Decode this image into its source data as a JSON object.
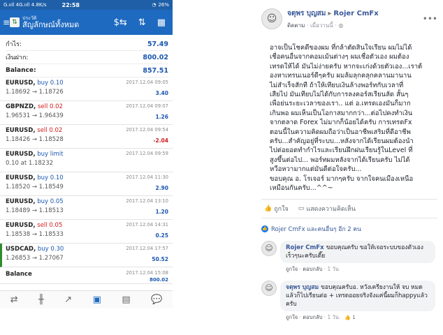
{
  "phone": {
    "status": {
      "left": "G.ııll 4G.ııll 4.8K/s",
      "time": "22:58",
      "right": "26%"
    },
    "app": {
      "sub": "ประวัติ",
      "title": "สัญลักษณ์ทั้งหมด"
    },
    "summary": [
      {
        "label": "กำไร:",
        "value": "57.49"
      },
      {
        "label": "เงินฝาก:",
        "value": "800.02"
      },
      {
        "label": "Balance:",
        "value": "857.51"
      }
    ],
    "trades": [
      {
        "symbol": "EURUSD,",
        "side": "buy 0.10",
        "type": "buy",
        "prices": "1.18692 → 1.18726",
        "date": "2017.12.04 09:05",
        "pl": "3.40",
        "plclass": "pos"
      },
      {
        "symbol": "GBPNZD,",
        "side": "sell 0.02",
        "type": "sell",
        "prices": "1.96531 → 1.96439",
        "date": "2017.12.04 09:07",
        "pl": "1.26",
        "plclass": "pos"
      },
      {
        "symbol": "EURUSD,",
        "side": "sell 0.02",
        "type": "sell",
        "prices": "1.18426 → 1.18528",
        "date": "2017.12.04 09:54",
        "pl": "-2.04",
        "plclass": "neg"
      },
      {
        "symbol": "EURUSD,",
        "side": "buy limit",
        "type": "buy",
        "prices": "0.10 at 1.18232",
        "date": "2017.12.04 09:59",
        "pl": "",
        "plclass": "pos"
      },
      {
        "symbol": "EURUSD,",
        "side": "buy 0.10",
        "type": "buy",
        "prices": "1.18520 → 1.18549",
        "date": "2017.12.04 11:30",
        "pl": "2.90",
        "plclass": "pos"
      },
      {
        "symbol": "EURUSD,",
        "side": "buy 0.05",
        "type": "buy",
        "prices": "1.18489 → 1.18513",
        "date": "2017.12.04 13:10",
        "pl": "1.20",
        "plclass": "pos"
      },
      {
        "symbol": "EURUSD,",
        "side": "sell 0.05",
        "type": "sell",
        "prices": "1.18538 → 1.18533",
        "date": "2017.12.04 14:31",
        "pl": "0.25",
        "plclass": "pos"
      },
      {
        "symbol": "USDCAD,",
        "side": "buy 0.30",
        "type": "buy",
        "prices": "1.26853 → 1.27067",
        "date": "2017.12.04 17:57",
        "pl": "50.52",
        "plclass": "pos"
      }
    ],
    "closed": {
      "label": "Balance",
      "date": "2017.12.04 15:08",
      "value": "800.02"
    }
  },
  "fb": {
    "post": {
      "author": "จตุพร บุญสม",
      "target": "Rojer CmFx",
      "follow": "ติดตาม",
      "time": "เมื่อวานนี้",
      "text": "อาจเป็นโชคดีของผม ที่กล้าตัดสินใจเรียน ผมไม่ได้\nเชื่อคนอื่นจากคอมเม้นต่างๆ ผมเชื่อตัวเอง ผมต้อง\nเทรดให้ได้ มันไม่ง่ายครับ หากจะเก่งด้วยตัวเอง...เราต้\nองหาเทรนเนอร์ดีๆครับ ผมล้มลุกคลุกคลานมานาน\nไม่สำเร็จสักที ถ้าให้เทียบเงินล้างพอร์ทกับเวลาที่\nเสียไป มันเทียบไม่ได้กับการลงคอร์สเรียนลัด สั้นๆ\nเพื่อย่นระยะเวลาของเรา.. แต่ อ.เทรดเองมันก็มาก\nเกินพอ ผมเห็นเป็นโอกาสมากกว่า...ต่อไปคงทำเงิน\nจากตลาด Forex ไม่มากก็น้อยได้ครับ การเทรดFx\nตอนนี้ในความคิดผมถือว่าเป็นอาชีพเสริมที่ดีอาชีพ\nครับ...สำคัญอยู่ที่ระบบ...หลังจากได้เรียนผมต้องนำ\nไปต่อยอดทำกำไรและเรียนฝึกฝนเรียนรู้ในLevel ที่\nสูงขึ้นต่อไป... พอร์ทผมหลังจากได้เรียนครับ ไม่ได้\nหวือหวามากแต่มันดีต่อใจครับ...\nขอบคุณ อ. โรเจอร์ มากๆครับ จากใจคนเมืองเหนือ\nเหมือนกันครับ...^^~",
      "like": "ถูกใจ",
      "comment": "แสดงความคิดเห็น",
      "likes_text": "Rojer CmFx และคนอื่นๆ อีก 2 คน"
    },
    "comments": [
      {
        "name": "Rojer CmFx",
        "text": "ขอบคุณครับ ขอให้เจอระบบของตัวเองเร็วๆนะครับเดี๊ย",
        "like": "ถูกใจ",
        "reply": "ตอบกลับ",
        "time": "1 วัน",
        "reacts": ""
      },
      {
        "name": "จตุพร บุญสม",
        "text": "ขอบคุณครับอ. หวังเครียงานให้ จบ หมดแล้วก็ไปเรียนต่อ + เทรดออยจริงจังแค่นี้ผมก็happyแล้วครับ",
        "like": "ถูกใจ",
        "reply": "ตอบกลับ",
        "time": "1 วัน",
        "reacts": "1"
      }
    ]
  }
}
